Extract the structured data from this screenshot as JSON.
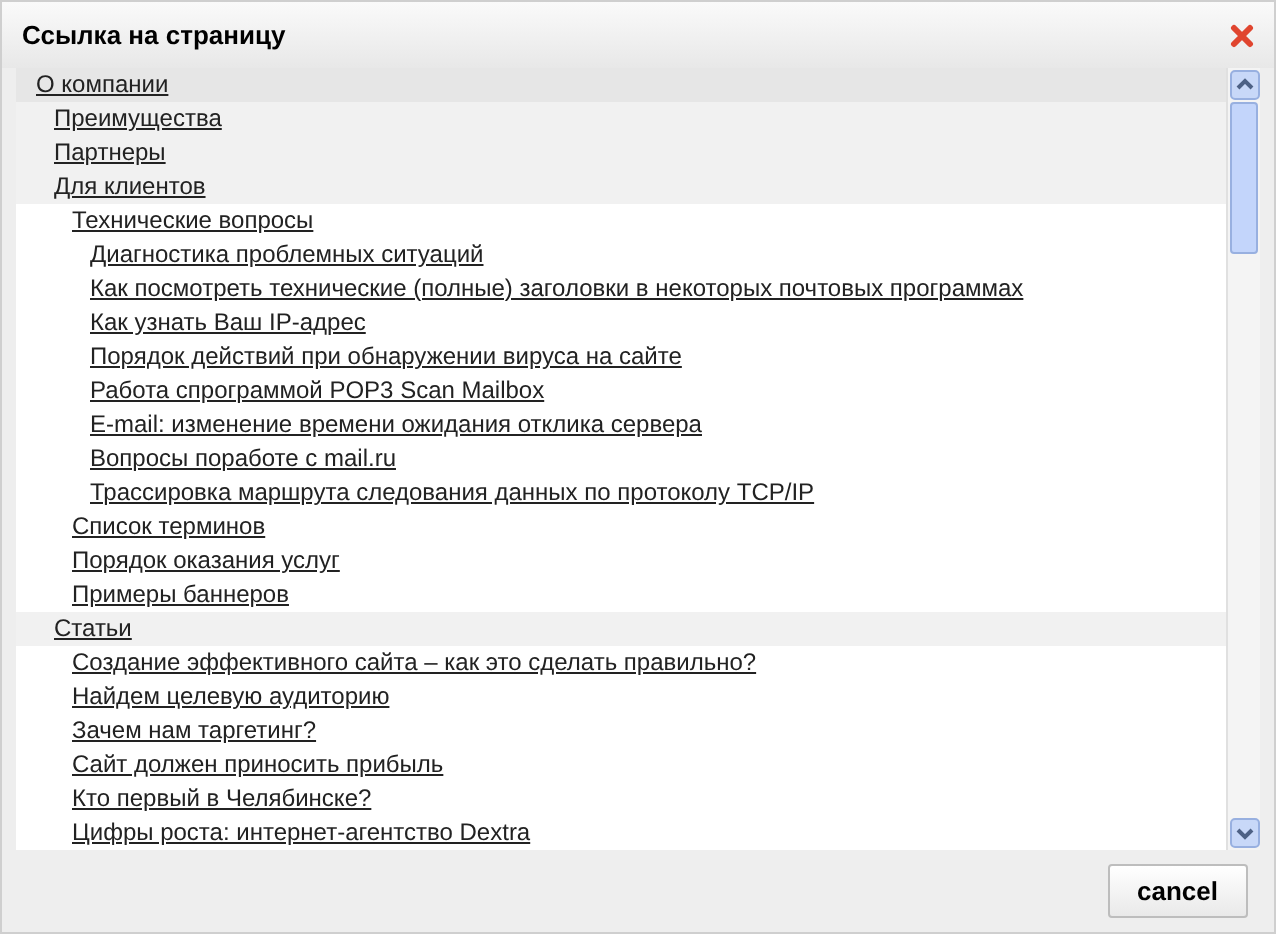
{
  "dialog": {
    "title": "Ссылка на страницу"
  },
  "tree": [
    {
      "label": "О компании",
      "children": [
        {
          "label": "Преимущества"
        },
        {
          "label": "Партнеры"
        },
        {
          "label": "Для клиентов",
          "children": [
            {
              "label": "Технические вопросы",
              "children": [
                {
                  "label": "Диагностика проблемных ситуаций"
                },
                {
                  "label": "Как посмотреть технические (полные) заголовки в некоторых почтовых программах"
                },
                {
                  "label": "Как узнать Ваш IP-адрес"
                },
                {
                  "label": "Порядок действий при обнаружении вируса на сайте"
                },
                {
                  "label": "Работа спрограммой POP3 Scan Mailbox"
                },
                {
                  "label": "E-mail: изменение времени ожидания отклика сервера"
                },
                {
                  "label": "Вопросы поработе с mail.ru"
                },
                {
                  "label": "Трассировка маршрута следования данных по протоколу TCP/IP"
                }
              ]
            },
            {
              "label": "Список терминов"
            },
            {
              "label": "Порядок оказания услуг"
            },
            {
              "label": "Примеры баннеров"
            }
          ]
        },
        {
          "label": "Статьи",
          "children": [
            {
              "label": "Создание эффективного сайта – как это сделать правильно?"
            },
            {
              "label": "Найдем целевую аудиторию"
            },
            {
              "label": "Зачем нам таргетинг?"
            },
            {
              "label": "Сайт должен приносить прибыль"
            },
            {
              "label": "Кто первый в Челябинске?"
            },
            {
              "label": "Цифры роста: интернет-агентство Dextra"
            }
          ]
        }
      ]
    }
  ],
  "buttons": [
    {
      "label": "cancel"
    }
  ]
}
